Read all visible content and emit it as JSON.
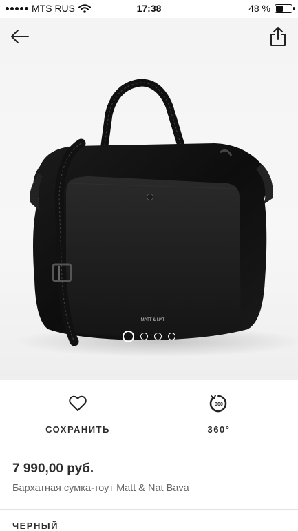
{
  "status_bar": {
    "carrier": "MTS RUS",
    "time": "17:38",
    "battery": "48 %",
    "battery_level": 0.48
  },
  "nav": {
    "back_icon": "arrow-left-icon",
    "share_icon": "share-icon"
  },
  "gallery": {
    "image_brand_text": "MATT & NAT",
    "image_count": 4,
    "active_index": 0
  },
  "actions": {
    "save_label": "СОХРАНИТЬ",
    "save_icon": "heart-icon",
    "view360_label": "360°",
    "view360_icon": "rotate-360-icon",
    "view360_icon_text": "360"
  },
  "product": {
    "price": "7 990,00 руб.",
    "name": "Бархатная сумка-тоут Matt & Nat Bava",
    "color_label": "ЧЕРНЫЙ"
  }
}
